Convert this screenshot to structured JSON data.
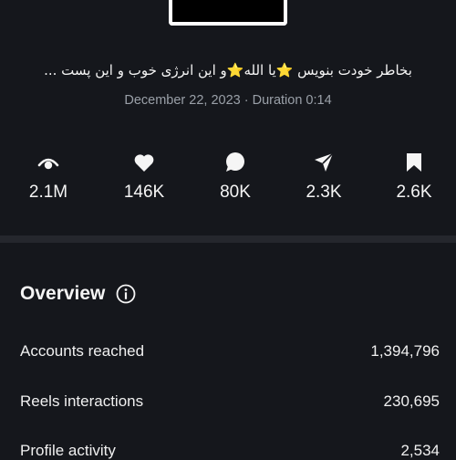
{
  "post": {
    "caption": "بخاطر خودت بنویس ⭐یا الله⭐و این انرژی خوب و این پست ...",
    "date": "December 22, 2023",
    "duration": "Duration 0:14"
  },
  "stats": [
    {
      "icon": "eye-icon",
      "value": "2.1M"
    },
    {
      "icon": "heart-icon",
      "value": "146K"
    },
    {
      "icon": "comment-icon",
      "value": "80K"
    },
    {
      "icon": "share-icon",
      "value": "2.3K"
    },
    {
      "icon": "bookmark-icon",
      "value": "2.6K"
    }
  ],
  "overview": {
    "title": "Overview",
    "rows": [
      {
        "label": "Accounts reached",
        "value": "1,394,796"
      },
      {
        "label": "Reels interactions",
        "value": "230,695"
      },
      {
        "label": "Profile activity",
        "value": "2,534"
      }
    ]
  },
  "colors": {
    "background": "#15171c",
    "divider": "#25272d",
    "muted": "#9aa0a8"
  }
}
